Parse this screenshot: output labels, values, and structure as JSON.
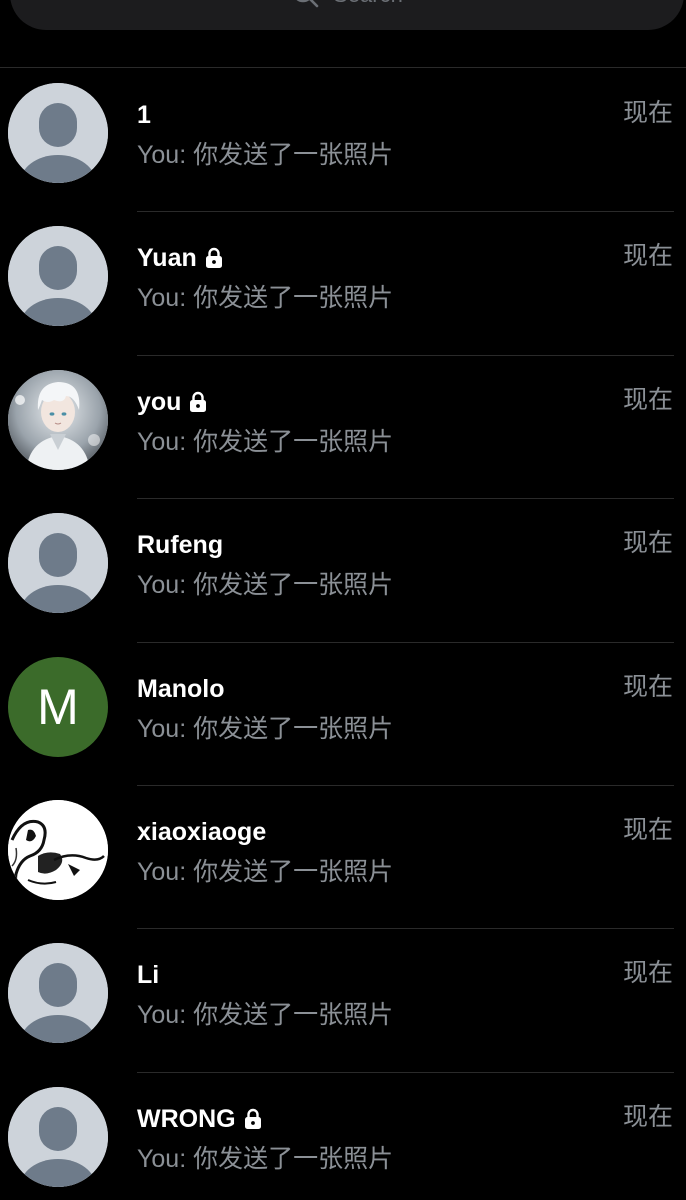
{
  "search": {
    "placeholder": "Search"
  },
  "conversations": [
    {
      "name": "1",
      "locked": false,
      "avatar": "default-person-icon",
      "preview": "You: 你发送了一张照片",
      "time": "现在"
    },
    {
      "name": "Yuan",
      "locked": true,
      "avatar": "default-person-icon",
      "preview": "You: 你发送了一张照片",
      "time": "现在"
    },
    {
      "name": "you",
      "locked": true,
      "avatar": "anime-portrait-photo",
      "preview": "You: 你发送了一张照片",
      "time": "现在"
    },
    {
      "name": "Rufeng",
      "locked": false,
      "avatar": "default-person-icon",
      "preview": "You: 你发送了一张照片",
      "time": "现在"
    },
    {
      "name": "Manolo",
      "locked": false,
      "avatar": "letter",
      "avatar_letter": "M",
      "avatar_color": "#3b6b2a",
      "preview": "You: 你发送了一张照片",
      "time": "现在"
    },
    {
      "name": "xiaoxiaoge",
      "locked": false,
      "avatar": "ink-sketch-image",
      "preview": "You: 你发送了一张照片",
      "time": "现在"
    },
    {
      "name": "Li",
      "locked": false,
      "avatar": "default-person-icon",
      "preview": "You: 你发送了一张照片",
      "time": "现在"
    },
    {
      "name": "WRONG",
      "locked": true,
      "avatar": "default-person-icon",
      "preview": "You: 你发送了一张照片",
      "time": "现在"
    }
  ],
  "colors": {
    "background": "#000000",
    "primary_text": "#ffffff",
    "secondary_text": "#8b9096",
    "divider": "#2a2a2a",
    "avatar_placeholder_bg": "#cdd3da",
    "avatar_placeholder_figure": "#6e7b8a"
  }
}
